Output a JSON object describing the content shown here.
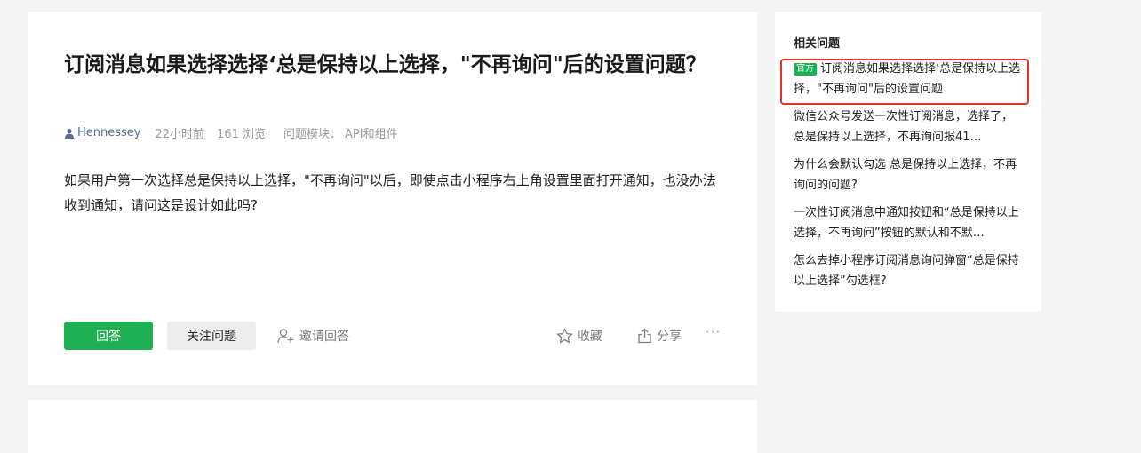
{
  "question": {
    "title": "订阅消息如果选择选择‘总是保持以上选择，\"不再询问\"后的设置问题？",
    "author": "Hennessey",
    "time": "22小时前",
    "views": "161 浏览",
    "module_label": "问题模块：",
    "module_value": "API和组件",
    "body": "如果用户第一次选择总是保持以上选择，\"不再询问\"以后，即使点击小程序右上角设置里面打开通知，也没办法收到通知，请问这是设计如此吗?"
  },
  "actions": {
    "answer_label": "回答",
    "follow_label": "关注问题",
    "invite_label": "邀请回答",
    "collect_label": "收藏",
    "share_label": "分享",
    "more_label": "···"
  },
  "related": {
    "title": "相关问题",
    "badge": "官方",
    "items": [
      "订阅消息如果选择选择‘总是保持以上选择，\"不再询问\"后的设置问题",
      "微信公众号发送一次性订阅消息，选择了，总是保持以上选择，不再询问报41…",
      "为什么会默认勾选 总是保持以上选择，不再询问的问题?",
      "一次性订阅消息中通知按钮和“总是保持以上选择，不再询问”按钮的默认和不默…",
      "怎么去掉小程序订阅消息询问弹窗“总是保持以上选择”勾选框?"
    ]
  },
  "colors": {
    "accent_green": "#1fb054",
    "author_blue": "#576b95",
    "highlight_red": "#e2352a"
  }
}
